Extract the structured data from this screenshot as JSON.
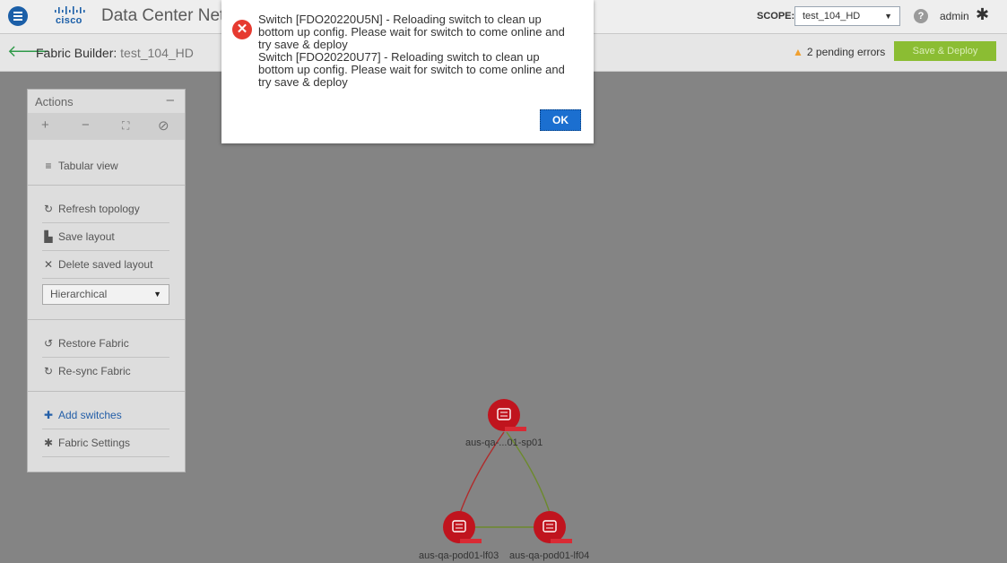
{
  "header": {
    "brand": "cisco",
    "app_title": "Data Center Network Manager",
    "scope_label": "SCOPE:",
    "scope_value": "test_104_HD",
    "user": "admin"
  },
  "subheader": {
    "fabric_label": "Fabric Builder:",
    "fabric_name": "test_104_HD",
    "pending_errors": "2 pending errors",
    "deploy_label": "Save & Deploy"
  },
  "actions_panel": {
    "title": "Actions",
    "collapse": "–",
    "zoom_in": "+",
    "zoom_out": "−",
    "fit": "⛶",
    "hide": "⊘",
    "tabular_view": "Tabular view",
    "refresh_topology": "Refresh topology",
    "save_layout": "Save layout",
    "delete_saved_layout": "Delete saved layout",
    "layout_option": "Hierarchical",
    "restore_fabric": "Restore Fabric",
    "resync_fabric": "Re-sync Fabric",
    "add_switches": "Add switches",
    "fabric_settings": "Fabric Settings"
  },
  "dialog": {
    "messages": [
      "Switch [FDO20220U5N] - Reloading switch to clean up bottom up config. Please wait for switch to come online and try save & deploy",
      "Switch [FDO20220U77] - Reloading switch to clean up bottom up config. Please wait for switch to come online and try save & deploy"
    ],
    "ok_label": "OK"
  },
  "topology": {
    "nodes": [
      {
        "label": "aus-qa-...01-sp01"
      },
      {
        "label": "aus-qa-pod01-lf03"
      },
      {
        "label": "aus-qa-pod01-lf04"
      }
    ],
    "colors": {
      "node": "#c0141e",
      "link_red": "#b02b2b",
      "link_green": "#6c8a2c"
    }
  }
}
